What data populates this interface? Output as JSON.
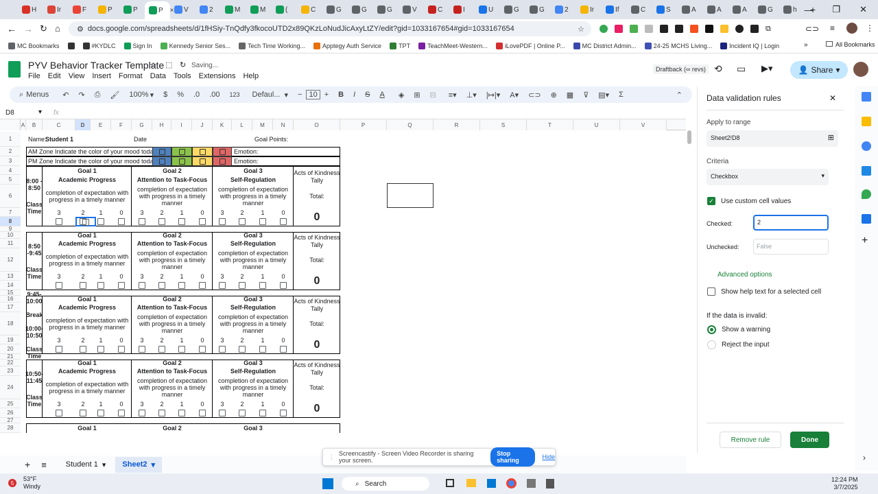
{
  "tabs": [
    "H",
    "Ir",
    "F",
    "P",
    "P",
    "P",
    "V",
    "2",
    "M",
    "M",
    "(",
    "C",
    "G",
    "G",
    "G",
    "V",
    "C",
    "I",
    "U",
    "G",
    "G",
    "2",
    "Ir",
    "If",
    "C",
    "S",
    "A",
    "A",
    "A",
    "G",
    "h"
  ],
  "tab_colors": [
    "#d93025",
    "#db4437",
    "#ea4335",
    "#f4b400",
    "#0f9d58",
    "#0f9d58",
    "#4285f4",
    "#4285f4",
    "#0f9d58",
    "#0f9d58",
    "#0f9d58",
    "#f4b400",
    "#5f6368",
    "#5f6368",
    "#5f6368",
    "#5f6368",
    "#c5221f",
    "#c5221f",
    "#1a73e8",
    "#5f6368",
    "#5f6368",
    "#4285f4",
    "#f4b400",
    "#1a73e8",
    "#5f6368",
    "#1a73e8",
    "#5f6368",
    "#5f6368",
    "#5f6368",
    "#5f6368",
    "#5f6368"
  ],
  "address": {
    "url": "docs.google.com/spreadsheets/d/1fHSiy-TnQdfy3fkocoUTD2x89QKzLoNudJicAxyLtZY/edit?gid=1033167654#gid=1033167654"
  },
  "bookmarks": [
    {
      "label": "MC Bookmarks",
      "color": "#5f6368"
    },
    {
      "label": "",
      "color": "#333"
    },
    {
      "label": "#KYDLC",
      "color": "#333"
    },
    {
      "label": "Sign In",
      "color": "#0f9d58"
    },
    {
      "label": "Kennedy Senior Ses...",
      "color": "#4caf50"
    },
    {
      "label": "Tech Time Working...",
      "color": "#666"
    },
    {
      "label": "Apptegy Auth Service",
      "color": "#e8710a"
    },
    {
      "label": "TPT",
      "color": "#2e7d32"
    },
    {
      "label": "TeachMeet-Western...",
      "color": "#7b1fa2"
    },
    {
      "label": "iLovePDF | Online P...",
      "color": "#d32f2f"
    },
    {
      "label": "MC District Admin...",
      "color": "#3949ab"
    },
    {
      "label": "24-25 MCHS Living...",
      "color": "#3f51b5"
    },
    {
      "label": "Incident IQ | Login",
      "color": "#1a237e"
    }
  ],
  "all_bookmarks": "All Bookmarks",
  "doc": {
    "title": "PYV Behavior Tracker Template",
    "saving": "Saving...",
    "menu": [
      "File",
      "Edit",
      "View",
      "Insert",
      "Format",
      "Data",
      "Tools",
      "Extensions",
      "Help"
    ],
    "draftback": "Draftback (∞ revs)",
    "share": "Share"
  },
  "toolbar": {
    "menus": "Menus",
    "zoom": "100%",
    "currency": "$",
    "percent": "%",
    "dec_dec": ".0",
    "inc_dec": ".00",
    "fmt": "123",
    "font": "Defaul...",
    "size": "10"
  },
  "namebox": "D8",
  "fx": "fx",
  "columns": [
    "A",
    "B",
    "C",
    "D",
    "E",
    "F",
    "G",
    "H",
    "I",
    "J",
    "K",
    "L",
    "M",
    "N",
    "O",
    "P",
    "Q",
    "R",
    "S",
    "T",
    "U",
    "V"
  ],
  "sheet": {
    "name_label": "Name:",
    "student": "Student 1",
    "date_label": "Date",
    "goal_points": "Goal Points:",
    "am": "AM Zone Indicate the color of your mood today:",
    "pm": "PM Zone Indicate the color of your mood today:",
    "emotion": "Emotion:",
    "goal1": "Goal 1",
    "goal2": "Goal 2",
    "goal3": "Goal 3",
    "g1sub": "Academic Progress",
    "g2sub": "Attention to Task-Focus",
    "g3sub": "Self-Regulation",
    "desc": "completion of expectation with progress in a timely manner",
    "acts": "Acts of Kindness Tally",
    "total": "Total:",
    "zero": "0",
    "scores": [
      "3",
      "2",
      "1",
      "0"
    ],
    "blocks": [
      {
        "time": "8:00 - 8:50",
        "label": "Class Time",
        "rows": [
          "4",
          "5",
          "6",
          "7",
          "8",
          "9"
        ]
      },
      {
        "time": "8:50 -9:45",
        "label": "Class Time",
        "rows": [
          "10",
          "11",
          "12",
          "13",
          "14",
          "15"
        ]
      },
      {
        "time": "9:45-10:00",
        "break": "Break",
        "time2": "10:00-10:50",
        "label": "Class Time",
        "rows": [
          "16",
          "17",
          "18",
          "19",
          "20",
          "21"
        ]
      },
      {
        "time": "10:50-11:45",
        "label": "Class Time",
        "rows": [
          "22",
          "23",
          "24",
          "25",
          "26",
          "27"
        ]
      }
    ],
    "last_row": "28"
  },
  "panel": {
    "title": "Data validation rules",
    "apply": "Apply to range",
    "range": "Sheet2!D8",
    "criteria": "Criteria",
    "criteria_val": "Checkbox",
    "custom": "Use custom cell values",
    "checked_label": "Checked:",
    "checked_val": "2",
    "unchecked_label": "Unchecked:",
    "unchecked_ph": "False",
    "advanced": "Advanced options",
    "helptext": "Show help text for a selected cell",
    "invalid": "If the data is invalid:",
    "warn": "Show a warning",
    "reject": "Reject the input",
    "remove": "Remove rule",
    "done": "Done"
  },
  "sheets": {
    "tab1": "Student 1",
    "tab2": "Sheet2"
  },
  "banner": {
    "text": "Screencastify - Screen Video Recorder is sharing your screen.",
    "stop": "Stop sharing",
    "hide": "Hide"
  },
  "taskbar": {
    "temp": "53°F",
    "weather": "Windy",
    "search": "Search",
    "time": "12:24 PM",
    "date": "3/7/2025",
    "badge": "5"
  }
}
